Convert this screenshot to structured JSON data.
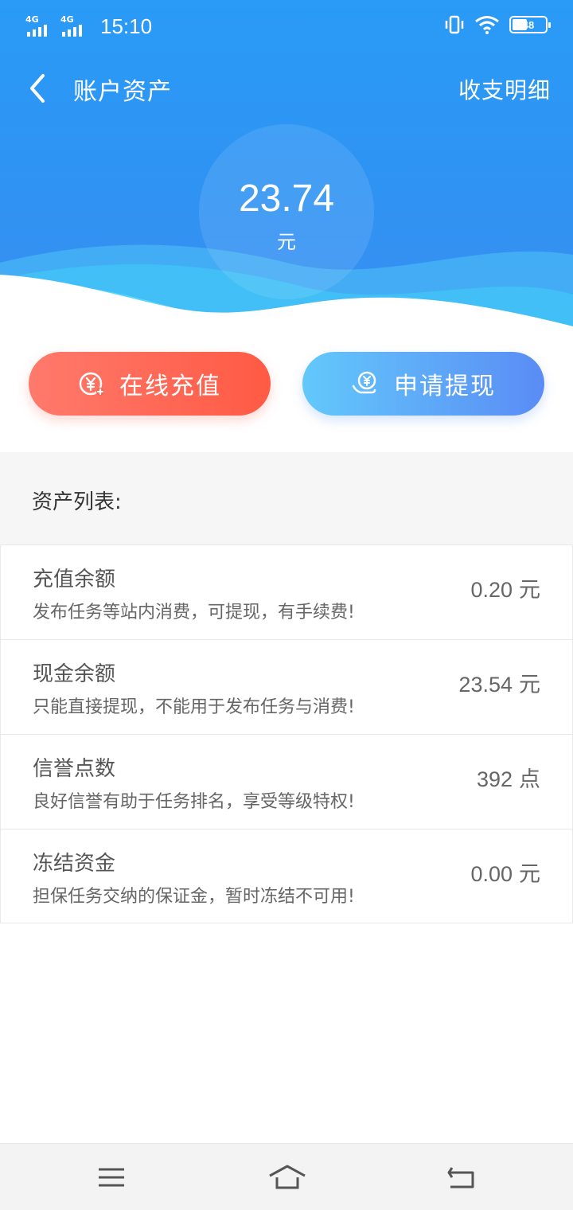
{
  "status_bar": {
    "signal1_label": "4G",
    "signal2_label": "4G",
    "time": "15:10",
    "battery": "48",
    "icons": [
      "signal-icon",
      "signal-icon",
      "vibrate-icon",
      "wifi-icon",
      "battery-icon"
    ]
  },
  "nav": {
    "back_icon": "chevron-left-icon",
    "title": "账户资产",
    "detail_link": "收支明细"
  },
  "balance": {
    "amount": "23.74",
    "unit": "元"
  },
  "actions": {
    "recharge": {
      "label": "在线充值",
      "icon": "yen-coin-icon",
      "color": "#ff5f4a"
    },
    "withdraw": {
      "label": "申请提现",
      "icon": "yen-hand-icon",
      "color": "#5aa6f8"
    }
  },
  "assets": {
    "title": "资产列表:",
    "items": [
      {
        "name": "充值余额",
        "desc": "发布任务等站内消费，可提现，有手续费!",
        "value": "0.20",
        "unit": "元"
      },
      {
        "name": "现金余额",
        "desc": "只能直接提现，不能用于发布任务与消费!",
        "value": "23.54",
        "unit": "元"
      },
      {
        "name": "信誉点数",
        "desc": "良好信誉有助于任务排名，享受等级特权!",
        "value": "392",
        "unit": "点"
      },
      {
        "name": "冻结资金",
        "desc": "担保任务交纳的保证金，暂时冻结不可用!",
        "value": "0.00",
        "unit": "元"
      }
    ]
  },
  "system_nav": {
    "icons": [
      "menu-icon",
      "home-icon",
      "back-icon"
    ]
  },
  "colors": {
    "header_blue": "#2a9bf7",
    "recharge_red": "#ff5a44",
    "withdraw_blue": "#5a8cf5"
  }
}
